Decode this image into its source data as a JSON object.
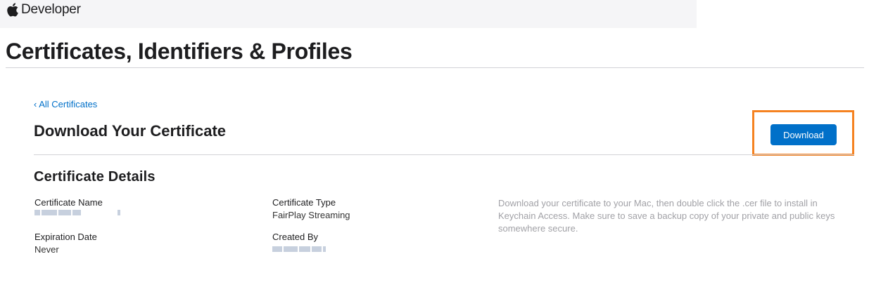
{
  "header": {
    "brand_icon": "apple-logo-icon",
    "brand_text": "Developer"
  },
  "page": {
    "title": "Certificates, Identifiers & Profiles"
  },
  "nav": {
    "back_link": "‹ All Certificates"
  },
  "section": {
    "heading": "Download Your Certificate",
    "download_label": "Download"
  },
  "details": {
    "heading": "Certificate Details",
    "certificate_name_label": "Certificate Name",
    "certificate_type_label": "Certificate Type",
    "certificate_type_value": "FairPlay Streaming",
    "expiration_label": "Expiration Date",
    "expiration_value": "Never",
    "created_by_label": "Created By",
    "help_text": "Download your certificate to your Mac, then double click the .cer file to install in Keychain Access. Make sure to save a backup copy of your private and public keys somewhere secure."
  },
  "colors": {
    "accent": "#0070c9",
    "highlight": "#f58220",
    "muted_text": "#a1a1a6"
  }
}
